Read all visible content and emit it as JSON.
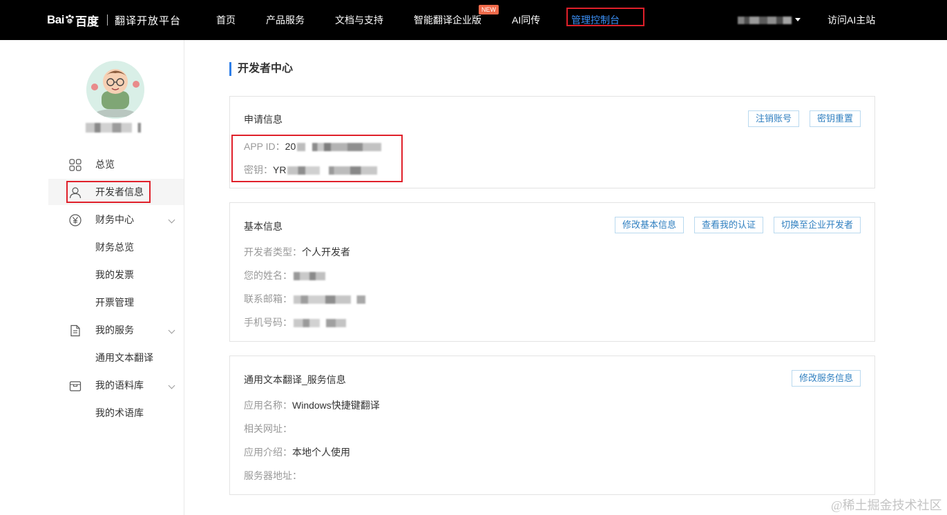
{
  "header": {
    "logo_text_left": "Bai",
    "logo_text_right": "百度",
    "platform_name": "翻译开放平台",
    "nav": [
      {
        "label": "首页"
      },
      {
        "label": "产品服务"
      },
      {
        "label": "文档与支持"
      },
      {
        "label": "智能翻译企业版",
        "badge": "NEW"
      },
      {
        "label": "AI同传"
      },
      {
        "label": "管理控制台",
        "active": true
      }
    ],
    "visit_ai": "访问AI主站",
    "active_color": "#3b8ff5",
    "badge_color": "#f06a4a"
  },
  "sidebar": {
    "items": [
      {
        "label": "总览",
        "icon": "grid-icon"
      },
      {
        "label": "开发者信息",
        "icon": "user-icon",
        "active": true
      },
      {
        "label": "财务中心",
        "icon": "yen-icon",
        "expandable": true
      },
      {
        "label": "财务总览"
      },
      {
        "label": "我的发票"
      },
      {
        "label": "开票管理"
      },
      {
        "label": "我的服务",
        "icon": "document-icon",
        "expandable": true
      },
      {
        "label": "通用文本翻译"
      },
      {
        "label": "我的语料库",
        "icon": "box-icon",
        "expandable": true
      },
      {
        "label": "我的术语库"
      }
    ]
  },
  "main": {
    "title": "开发者中心",
    "application": {
      "title": "申请信息",
      "buttons": [
        "注销账号",
        "密钥重置"
      ],
      "app_id_label": "APP ID：",
      "app_id_value": "20",
      "secret_label": "密钥：",
      "secret_value": "YR"
    },
    "basic": {
      "title": "基本信息",
      "buttons": [
        "修改基本信息",
        "查看我的认证",
        "切换至企业开发者"
      ],
      "type_label": "开发者类型：",
      "type_value": "个人开发者",
      "name_label": "您的姓名：",
      "email_label": "联系邮箱：",
      "phone_label": "手机号码："
    },
    "service": {
      "title": "通用文本翻译_服务信息",
      "button": "修改服务信息",
      "app_name_label": "应用名称：",
      "app_name_value": "Windows快捷键翻译",
      "url_label": "相关网址：",
      "intro_label": "应用介绍：",
      "intro_value": "本地个人使用",
      "server_label": "服务器地址："
    }
  },
  "watermark": "@稀土掘金技术社区",
  "accent_color": "#2f7fe8",
  "highlight_color": "#e0202a"
}
